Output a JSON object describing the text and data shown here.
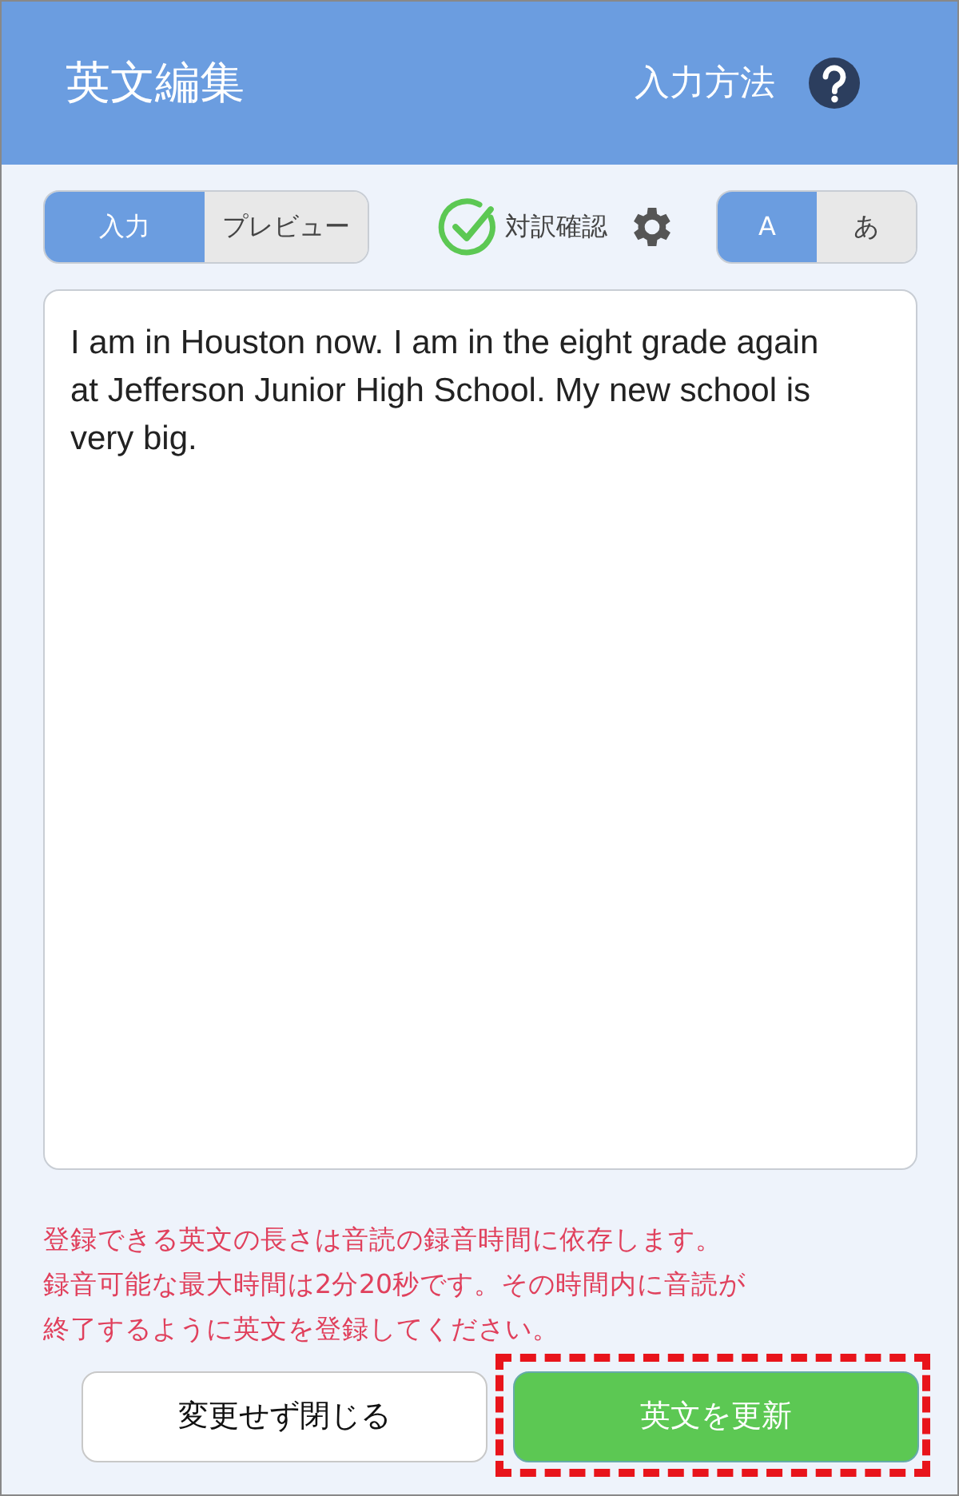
{
  "header": {
    "title": "英文編集",
    "help_label": "入力方法"
  },
  "mode_tabs": [
    {
      "label": "入力",
      "selected": true
    },
    {
      "label": "プレビュー",
      "selected": false
    }
  ],
  "translation_check": {
    "label": "対訳確認",
    "checked": true
  },
  "script_tabs": [
    {
      "label": "A",
      "selected": true
    },
    {
      "label": "あ",
      "selected": false
    }
  ],
  "editor": {
    "value": "I am in Houston now. I am in the eight grade again at Jefferson Junior High School. My new school is very big."
  },
  "notice_lines": [
    "登録できる英文の長さは音読の録音時間に依存します。",
    "録音可能な最大時間は2分20秒です。その時間内に音読が",
    "終了するように英文を登録してください。"
  ],
  "buttons": [
    {
      "label": "変更せず閉じる",
      "kind": "secondary",
      "highlighted": false
    },
    {
      "label": "英文を更新",
      "kind": "primary",
      "highlighted": true
    }
  ]
}
